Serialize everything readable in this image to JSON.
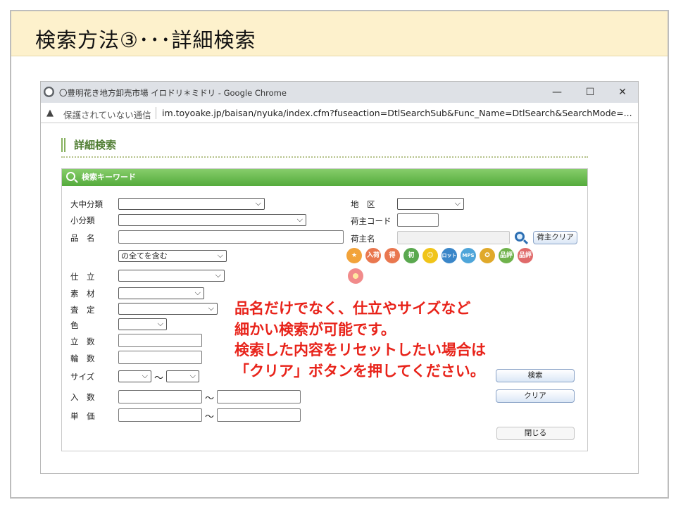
{
  "slide": {
    "title": "検索方法③･･･詳細検索"
  },
  "browser": {
    "window_title": "〇豊明花き地方卸売市場 イロドリ＊ミドリ - Google Chrome",
    "security_text": "保護されていない通信",
    "url": "im.toyoake.jp/baisan/nyuka/index.cfm?fuseaction=DtlSearchSub&Func_Name=DtlSearch&SearchMode=..."
  },
  "page": {
    "heading": "詳細検索",
    "panel_title": "検索キーワード"
  },
  "form": {
    "category_label": "大中分類",
    "subcategory_label": "小分類",
    "product_label": "品　名",
    "product_match_option": "の全てを含む",
    "finish_label": "仕　立",
    "material_label": "素　材",
    "grade_label": "査　定",
    "color_label": "色",
    "stand_count_label": "立　数",
    "flower_count_label": "輪　数",
    "size_label": "サイズ",
    "size_sep": "～",
    "quantity_label": "入　数",
    "quantity_sep": "～",
    "unit_price_label": "単　価",
    "unit_price_sep": "～",
    "region_label": "地　区",
    "shipper_code_label": "荷主コード",
    "shipper_name_label": "荷主名",
    "shipper_clear_label": "荷主クリア",
    "search_button": "検索",
    "clear_button": "クリア",
    "close_button": "閉じる"
  },
  "badges": [
    {
      "label": "★",
      "color": "#f2a33a"
    },
    {
      "label": "入荷",
      "color": "#e9774f"
    },
    {
      "label": "得",
      "color": "#e9774f"
    },
    {
      "label": "初",
      "color": "#5aa84f"
    },
    {
      "label": "☺",
      "color": "#f0c419"
    },
    {
      "label": "ロット",
      "color": "#3a86c8"
    },
    {
      "label": "MPS",
      "color": "#4ea5d9"
    },
    {
      "label": "✪",
      "color": "#e0a92a"
    },
    {
      "label": "品評",
      "color": "#6fb24b"
    },
    {
      "label": "品評",
      "color": "#e06a6a"
    }
  ],
  "annotation": {
    "line1": "品名だけでなく、仕立やサイズなど",
    "line2": "細かい検索が可能です。",
    "line3": "検索した内容をリセットしたい場合は",
    "line4": "「クリア」ボタンを押してください。"
  }
}
